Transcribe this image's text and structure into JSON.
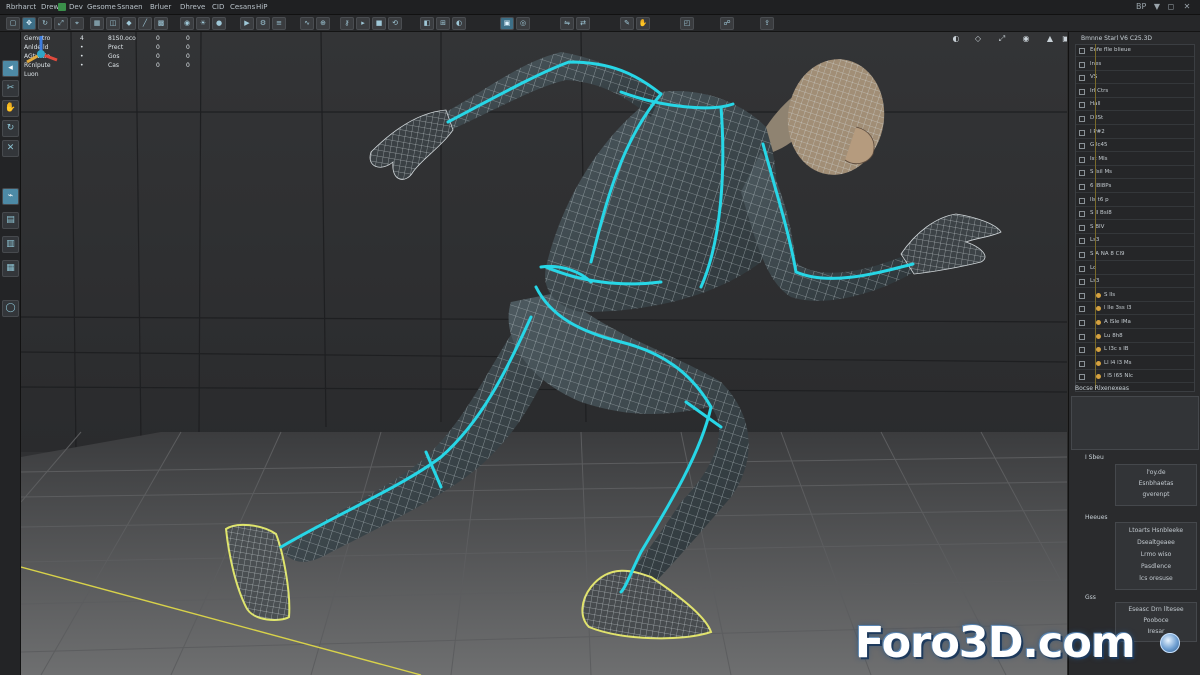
{
  "menu": {
    "items": [
      "Rbrharct",
      "Drew",
      "Dev",
      "Gesome",
      "Ssnaen",
      "Brluer",
      "Dhreve",
      "CID",
      "Cesans",
      "HiP"
    ],
    "window_controls": [
      "BP",
      "▼",
      "◻",
      "✕"
    ]
  },
  "toolbar": {
    "icons": [
      "select-icon",
      "move-icon",
      "rotate-icon",
      "scale-icon",
      "snap-icon",
      "render-icon",
      "camera-icon",
      "light-icon",
      "grid-icon"
    ]
  },
  "left_tools": [
    "select-tool-icon",
    "lasso-tool-icon",
    "move-tool-icon",
    "rotate-tool-icon",
    "scale-tool-icon",
    "edit-tool-icon",
    "panel-tool-icon",
    "layer-tool-icon",
    "grid-tool-icon",
    "sphere-tool-icon"
  ],
  "viewport": {
    "stats": [
      {
        "label": "Gemutro",
        "v1": "4",
        "v2": "81S0.oco",
        "v3": "0",
        "v4": "0"
      },
      {
        "label": "Anlde ld",
        "v1": "•",
        "v2": "Prect",
        "v3": "0",
        "v4": "0"
      },
      {
        "label": "AGtwrtie",
        "v1": "•",
        "v2": "Gos",
        "v3": "0",
        "v4": "0"
      },
      {
        "label": "Rcnlpute",
        "v1": "•",
        "v2": "Cas",
        "v3": "0",
        "v4": "0"
      },
      {
        "label": "Luon",
        "v1": "",
        "v2": "",
        "v3": "",
        "v4": ""
      }
    ]
  },
  "right_panel": {
    "header": "Bmnne Starl      V6 C25.3D",
    "outliner": [
      {
        "a": "",
        "b": "Eefe flle blieue"
      },
      {
        "a": "",
        "b": "lnes"
      },
      {
        "a": "",
        "b": "VS"
      },
      {
        "a": "",
        "b": "Irl Ctrs"
      },
      {
        "a": "",
        "b": "Hall"
      },
      {
        "a": "",
        "b": "D lSt"
      },
      {
        "a": "",
        "b": "I P#2"
      },
      {
        "a": "",
        "b": "G lc45"
      },
      {
        "a": "",
        "b": "Ist Mls"
      },
      {
        "a": "",
        "b": "S lsil Ms"
      },
      {
        "a": "",
        "b": "6 l8l8Ps"
      },
      {
        "a": "",
        "b": "lls t6 p"
      },
      {
        "a": "",
        "b": "S ll Bsl8"
      },
      {
        "a": "",
        "b": "S BIV"
      },
      {
        "a": "",
        "b": "Ls3"
      },
      {
        "a": "",
        "b": "S A NA 8 Cl9"
      },
      {
        "a": "",
        "b": "Lo"
      },
      {
        "a": "",
        "b": "Ls3"
      },
      {
        "a": "",
        "b": "S lls"
      },
      {
        "a": "",
        "b": "l lle 3ss l3"
      },
      {
        "a": "",
        "b": "A lSle lMa"
      },
      {
        "a": "",
        "b": "Lu 8h8"
      },
      {
        "a": "",
        "b": "L l3c s lB"
      },
      {
        "a": "",
        "b": "Ll l4 l3 Ms"
      },
      {
        "a": "",
        "b": "l l5 l65 Nlc"
      }
    ],
    "section1_title": "Bocse Rlxenexeas",
    "section2_title": "I Sbeu",
    "section2_lines": [
      "l'oy.de",
      "Esnbhaetas",
      "gverenpt"
    ],
    "section3_title": "Heeues",
    "section3_lines": [
      "Ltoarts Hsnbleeke",
      "Dsealtgeaee",
      "Lrmo wiso",
      "Pasdlence",
      "lcs oresuse"
    ],
    "section4_title": "Gss",
    "section4_lines": [
      "Eseasc Drn lltesee",
      "Pooboce",
      "Iresar"
    ]
  },
  "watermark": "Foro3D.com",
  "colors": {
    "accent_cyan": "#27d6e6",
    "highlight_blue": "#4d8aa6",
    "viewport_bg": "#303133"
  }
}
